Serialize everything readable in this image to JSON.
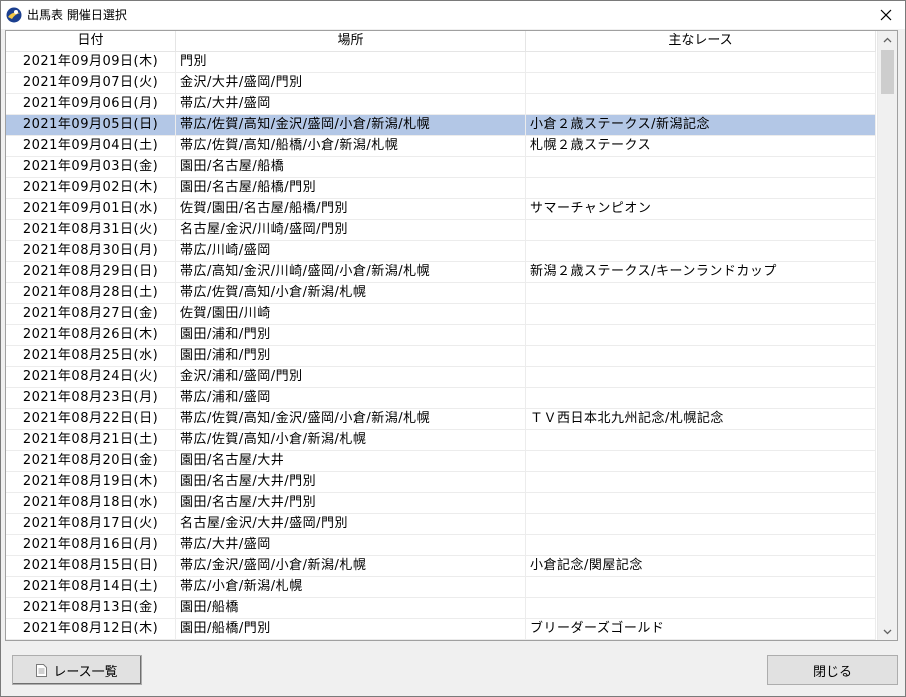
{
  "window": {
    "title": "出馬表 開催日選択"
  },
  "columns": [
    "日付",
    "場所",
    "主なレース"
  ],
  "rows": [
    {
      "date": "2021年09月09日(木)",
      "place": "門別",
      "race": ""
    },
    {
      "date": "2021年09月07日(火)",
      "place": "金沢/大井/盛岡/門別",
      "race": ""
    },
    {
      "date": "2021年09月06日(月)",
      "place": "帯広/大井/盛岡",
      "race": ""
    },
    {
      "date": "2021年09月05日(日)",
      "place": "帯広/佐賀/高知/金沢/盛岡/小倉/新潟/札幌",
      "race": "小倉２歳ステークス/新潟記念",
      "selected": true
    },
    {
      "date": "2021年09月04日(土)",
      "place": "帯広/佐賀/高知/船橋/小倉/新潟/札幌",
      "race": "札幌２歳ステークス"
    },
    {
      "date": "2021年09月03日(金)",
      "place": "園田/名古屋/船橋",
      "race": ""
    },
    {
      "date": "2021年09月02日(木)",
      "place": "園田/名古屋/船橋/門別",
      "race": ""
    },
    {
      "date": "2021年09月01日(水)",
      "place": "佐賀/園田/名古屋/船橋/門別",
      "race": "サマーチャンピオン"
    },
    {
      "date": "2021年08月31日(火)",
      "place": "名古屋/金沢/川崎/盛岡/門別",
      "race": ""
    },
    {
      "date": "2021年08月30日(月)",
      "place": "帯広/川崎/盛岡",
      "race": ""
    },
    {
      "date": "2021年08月29日(日)",
      "place": "帯広/高知/金沢/川崎/盛岡/小倉/新潟/札幌",
      "race": "新潟２歳ステークス/キーンランドカップ"
    },
    {
      "date": "2021年08月28日(土)",
      "place": "帯広/佐賀/高知/小倉/新潟/札幌",
      "race": ""
    },
    {
      "date": "2021年08月27日(金)",
      "place": "佐賀/園田/川崎",
      "race": ""
    },
    {
      "date": "2021年08月26日(木)",
      "place": "園田/浦和/門別",
      "race": ""
    },
    {
      "date": "2021年08月25日(水)",
      "place": "園田/浦和/門別",
      "race": ""
    },
    {
      "date": "2021年08月24日(火)",
      "place": "金沢/浦和/盛岡/門別",
      "race": ""
    },
    {
      "date": "2021年08月23日(月)",
      "place": "帯広/浦和/盛岡",
      "race": ""
    },
    {
      "date": "2021年08月22日(日)",
      "place": "帯広/佐賀/高知/金沢/盛岡/小倉/新潟/札幌",
      "race": "ＴＶ西日本北九州記念/札幌記念"
    },
    {
      "date": "2021年08月21日(土)",
      "place": "帯広/佐賀/高知/小倉/新潟/札幌",
      "race": ""
    },
    {
      "date": "2021年08月20日(金)",
      "place": "園田/名古屋/大井",
      "race": ""
    },
    {
      "date": "2021年08月19日(木)",
      "place": "園田/名古屋/大井/門別",
      "race": ""
    },
    {
      "date": "2021年08月18日(水)",
      "place": "園田/名古屋/大井/門別",
      "race": ""
    },
    {
      "date": "2021年08月17日(火)",
      "place": "名古屋/金沢/大井/盛岡/門別",
      "race": ""
    },
    {
      "date": "2021年08月16日(月)",
      "place": "帯広/大井/盛岡",
      "race": ""
    },
    {
      "date": "2021年08月15日(日)",
      "place": "帯広/金沢/盛岡/小倉/新潟/札幌",
      "race": "小倉記念/関屋記念"
    },
    {
      "date": "2021年08月14日(土)",
      "place": "帯広/小倉/新潟/札幌",
      "race": ""
    },
    {
      "date": "2021年08月13日(金)",
      "place": "園田/船橋",
      "race": ""
    },
    {
      "date": "2021年08月12日(木)",
      "place": "園田/船橋/門別",
      "race": "ブリーダーズゴールド"
    }
  ],
  "buttons": {
    "race_list": "レース一覧",
    "close": "閉じる"
  },
  "colors": {
    "selected_row": "#b3c7e6"
  }
}
